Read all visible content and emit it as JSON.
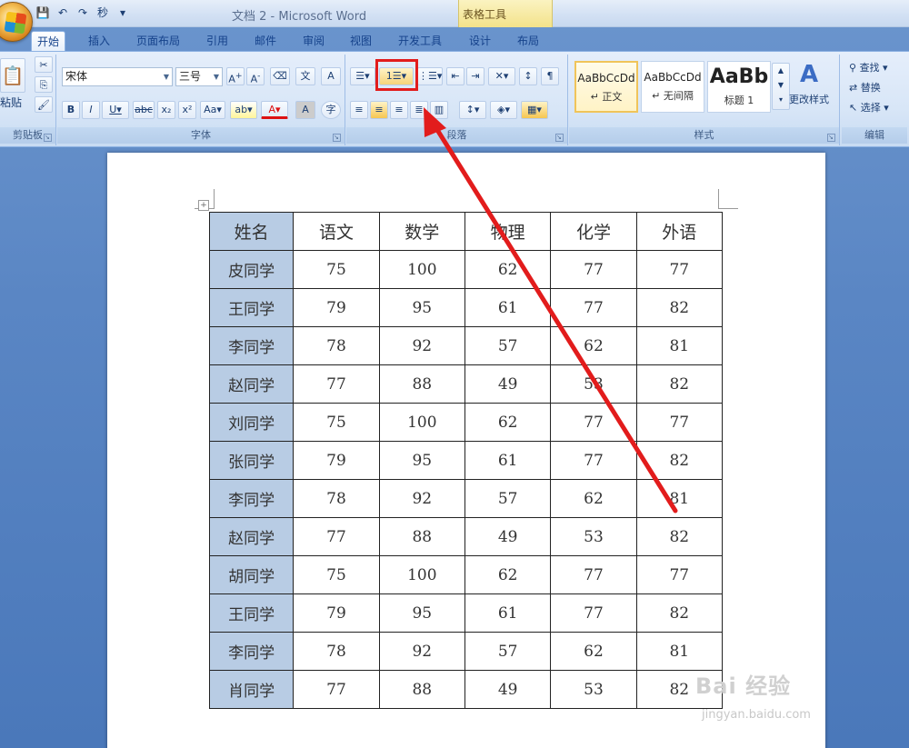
{
  "window": {
    "title": "文档 2 - Microsoft Word",
    "context_group": "表格工具"
  },
  "qat": {
    "save": "💾",
    "undo": "↶",
    "redo": "↷",
    "format": "秒",
    "more": "▾"
  },
  "tabs": [
    {
      "label": "开始",
      "active": true
    },
    {
      "label": "插入"
    },
    {
      "label": "页面布局"
    },
    {
      "label": "引用"
    },
    {
      "label": "邮件"
    },
    {
      "label": "审阅"
    },
    {
      "label": "视图"
    },
    {
      "label": "开发工具"
    },
    {
      "label": "设计"
    },
    {
      "label": "布局"
    }
  ],
  "ribbon": {
    "clipboard": {
      "label": "剪贴板",
      "paste": "粘贴"
    },
    "font": {
      "label": "字体",
      "font_name": "宋体",
      "font_size": "三号"
    },
    "paragraph": {
      "label": "段落"
    },
    "styles": {
      "label": "样式",
      "items": [
        {
          "sample": "AaBbCcDd",
          "name": "↵ 正文"
        },
        {
          "sample": "AaBbCcDd",
          "name": "↵ 无间隔"
        },
        {
          "sample": "AaBb",
          "name": "标题 1"
        }
      ],
      "change": "更改样式"
    },
    "editing": {
      "label": "编辑",
      "find": "查找",
      "replace": "替换",
      "select": "选择"
    }
  },
  "table": {
    "headers": [
      "姓名",
      "语文",
      "数学",
      "物理",
      "化学",
      "外语"
    ],
    "rows": [
      [
        "皮同学",
        "75",
        "100",
        "62",
        "77",
        "77"
      ],
      [
        "王同学",
        "79",
        "95",
        "61",
        "77",
        "82"
      ],
      [
        "李同学",
        "78",
        "92",
        "57",
        "62",
        "81"
      ],
      [
        "赵同学",
        "77",
        "88",
        "49",
        "53",
        "82"
      ],
      [
        "刘同学",
        "75",
        "100",
        "62",
        "77",
        "77"
      ],
      [
        "张同学",
        "79",
        "95",
        "61",
        "77",
        "82"
      ],
      [
        "李同学",
        "78",
        "92",
        "57",
        "62",
        "81"
      ],
      [
        "赵同学",
        "77",
        "88",
        "49",
        "53",
        "82"
      ],
      [
        "胡同学",
        "75",
        "100",
        "62",
        "77",
        "77"
      ],
      [
        "王同学",
        "79",
        "95",
        "61",
        "77",
        "82"
      ],
      [
        "李同学",
        "78",
        "92",
        "57",
        "62",
        "81"
      ],
      [
        "肖同学",
        "77",
        "88",
        "49",
        "53",
        "82"
      ]
    ]
  },
  "watermark": {
    "brand": "Bai 经验",
    "url": "jingyan.baidu.com"
  },
  "colors": {
    "annotation": "#e21c1c",
    "name_column": "#b8cce4"
  }
}
